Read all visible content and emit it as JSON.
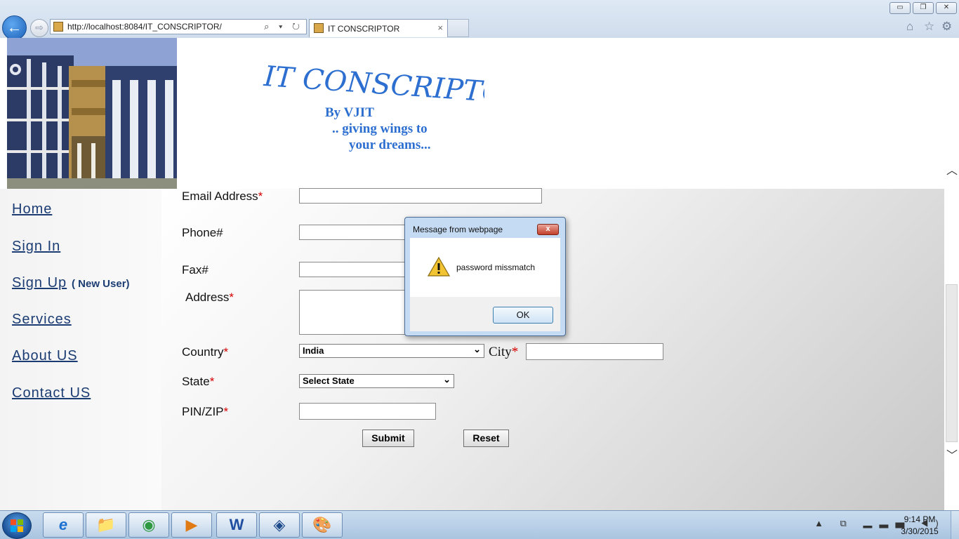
{
  "browser": {
    "window_controls": {
      "minimize": "▭",
      "restore": "❐",
      "close": "✕"
    },
    "back_glyph": "←",
    "forward_glyph": "⇨",
    "address": "http://localhost:8084/IT_CONSCRIPTOR/",
    "address_icons": "⌕ ▾ ↻",
    "tab_title": "IT CONSCRIPTOR",
    "tab_close": "×",
    "toolbar_icons": {
      "home": "⌂",
      "favorites": "☆",
      "tools": "⚙"
    }
  },
  "header": {
    "logo_text": "IT CONSCRIPTOR",
    "by_line": "By VJIT",
    "tagline_1": ".. giving wings to",
    "tagline_2": "your dreams..."
  },
  "sidebar": {
    "items": [
      {
        "label": "Home"
      },
      {
        "label": "Sign In"
      },
      {
        "label": "Sign Up",
        "suffix": "( New User)"
      },
      {
        "label": "Services"
      },
      {
        "label": "About US"
      },
      {
        "label": "Contact US"
      }
    ]
  },
  "form": {
    "email_label": "Email Address",
    "phone_label": "Phone#",
    "fax_label": "Fax#",
    "address_label": "Address",
    "country_label": "Country",
    "country_value": "India",
    "city_label": "City",
    "state_label": "State",
    "state_value": "Select State",
    "pin_label": "PIN/ZIP",
    "required_mark": "*",
    "submit_label": "Submit",
    "reset_label": "Reset"
  },
  "dialog": {
    "title": "Message from webpage",
    "close_glyph": "x",
    "message": "password missmatch",
    "ok_label": "OK"
  },
  "taskbar": {
    "apps": [
      "internet-explorer",
      "file-explorer",
      "chrome",
      "media-player",
      "word",
      "virtualbox",
      "paint"
    ],
    "app_glyphs": [
      "e",
      "📁",
      "◉",
      "▶",
      "W",
      "◈",
      "🎨"
    ],
    "tray_icons": "▲ ⧉ ▂▃▅ ◀) ⚑",
    "time": "9:14 PM",
    "date": "3/30/2015"
  },
  "colors": {
    "link": "#1b3c73",
    "required": "#d40000",
    "logo_blue": "#2d6fd0"
  }
}
